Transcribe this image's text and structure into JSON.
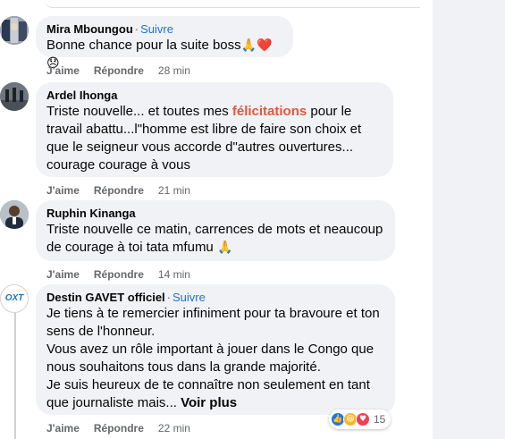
{
  "colors": {
    "page_bg": "#f0f2f5",
    "bubble_bg": "#f0f2f5",
    "follow_link": "#216fdb",
    "highlight": "#e2563b",
    "meta_text": "#65676b"
  },
  "common": {
    "like_label": "J'aime",
    "reply_label": "Répondre",
    "separator": "·"
  },
  "comments": [
    {
      "author": "Mira Mboungou",
      "follow": "Suivre",
      "text": "Bonne chance pour la suite boss",
      "emojis": "🙏❤️😞",
      "time": "28 min"
    },
    {
      "author": "Ardel Ihonga",
      "text_before": "Triste nouvelle... et toutes mes ",
      "text_highlight": "félicitations",
      "text_after": " pour le travail abattu...l\"homme est libre de faire son choix et que le seigneur vous accorde d\"autres ouvertures... courage courage à vous",
      "time": "21 min"
    },
    {
      "author": "Ruphin Kinanga",
      "text": "Triste nouvelle ce matin, carrences de mots et neaucoup de courage à toi tata mfumu",
      "emojis": "🙏",
      "time": "14 min"
    },
    {
      "author": "Destin GAVET officiel",
      "follow": "Suivre",
      "paragraphs": [
        "Je tiens à te remercier infiniment pour ta bravoure et ton sens de l'honneur.",
        "Vous avez un rôle important à jouer dans le Congo que nous souhaitons tous dans la grande majorité.",
        "Je suis heureux de te connaître non seulement en tant que journaliste mais... "
      ],
      "see_more": "Voir plus",
      "time": "22 min",
      "avatar_text": "OXT",
      "reaction_count": "15",
      "reaction_icons": [
        "like-icon",
        "haha-icon",
        "love-icon"
      ]
    }
  ]
}
